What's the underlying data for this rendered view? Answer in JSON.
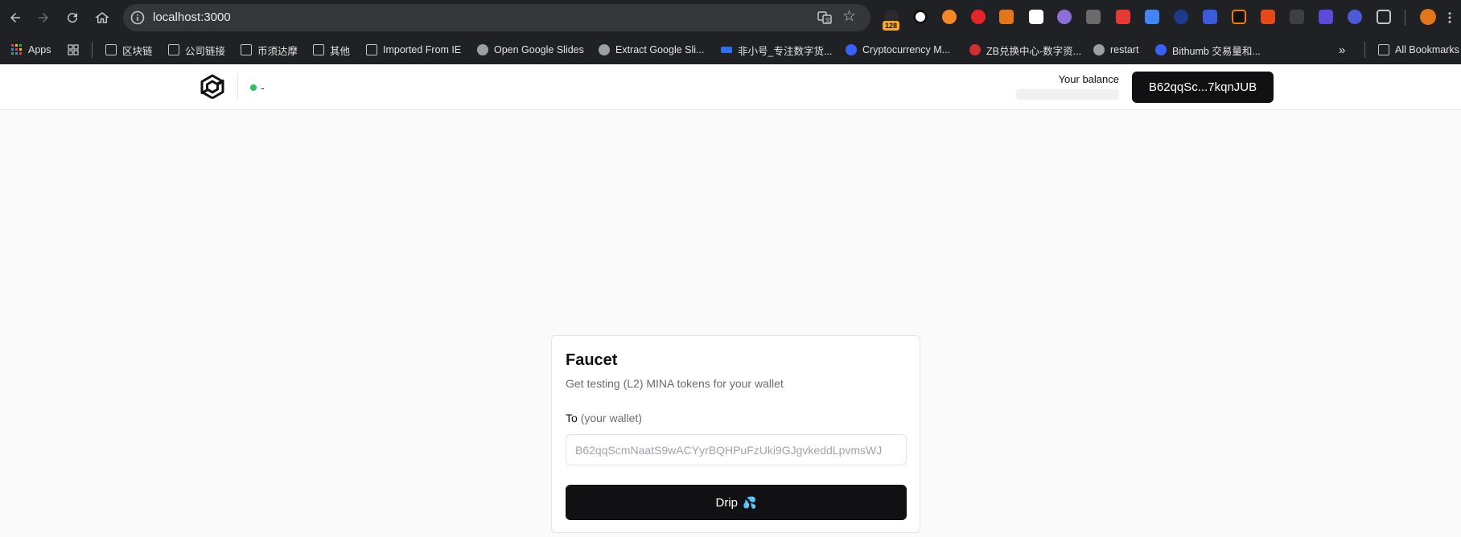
{
  "browser": {
    "url": "localhost:3000",
    "extension_badge": "128",
    "bookmarks": [
      {
        "label": "Apps",
        "icon": "apps-icon"
      },
      {
        "label": "",
        "icon": "grid-icon"
      },
      {
        "label": "区块链",
        "icon": "folder-icon"
      },
      {
        "label": "公司链接",
        "icon": "folder-icon"
      },
      {
        "label": "币须达摩",
        "icon": "folder-icon"
      },
      {
        "label": "其他",
        "icon": "folder-icon"
      },
      {
        "label": "Imported From IE",
        "icon": "folder-icon"
      },
      {
        "label": "Open Google Slides",
        "icon": "globe-icon"
      },
      {
        "label": "Extract Google Sli...",
        "icon": "globe-icon"
      },
      {
        "label": "非小号_专注数字货...",
        "icon": "feixiaohao-icon"
      },
      {
        "label": "Cryptocurrency M...",
        "icon": "coinmarketcap-icon"
      },
      {
        "label": "ZB兑换中心-数字资...",
        "icon": "zb-icon"
      },
      {
        "label": "restart",
        "icon": "globe-icon"
      },
      {
        "label": "Bithumb 交易量和...",
        "icon": "bithumb-icon"
      }
    ],
    "all_bookmarks_label": "All Bookmarks",
    "overflow_label": "»"
  },
  "app": {
    "status_text": "-",
    "balance_label": "Your balance",
    "wallet_button_label": "B62qqSc...7kqnJUB"
  },
  "faucet": {
    "title": "Faucet",
    "description": "Get testing (L2) MINA tokens for your wallet",
    "to_label": "To",
    "to_hint": "(your wallet)",
    "input_placeholder": "B62qqScmNaatS9wACYyrBQHPuFzUki9GJgvkeddLpvmsWJ",
    "drip_label": "Drip"
  },
  "colors": {
    "status_dot": "#22c55e",
    "primary_button": "#111113",
    "chrome_bg": "#202124"
  }
}
